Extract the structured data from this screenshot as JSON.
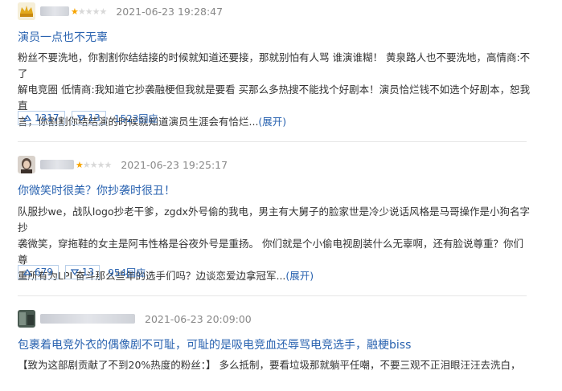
{
  "reviews": [
    {
      "stars": {
        "on": "★",
        "off": "★★★★"
      },
      "time": "2021-06-23 19:28:47",
      "title": "演员一点也不无辜",
      "lines": [
        "粉丝不要洗地，你割割你结结接的时候就知道还要接，那就别怕有人骂 谁演谁糊！ 黄泉路人也不要洗地，高情商:不了",
        "解电竞圈 低情商:我知道它抄袭融梗但我就是要看 买那么多热搜不能找个好剧本！演员恰烂钱不如选个好剧本，恕我直",
        "言，你割割你结结演的时候就知道演员生涯会有恰烂..."
      ],
      "expand": "(展开)",
      "upvotes": "1317",
      "downvotes": "13",
      "replies": "1523回应"
    },
    {
      "stars": {
        "on": "★",
        "off": "★★★★"
      },
      "time": "2021-06-23 19:25:17",
      "title": "你微笑时很美？你抄袭时很丑！",
      "lines": [
        "队服抄we，战队logo抄老干爹，zgdx外号偷的我电，男主有大舅子的脸家世是冷少说话风格是马哥操作是小狗名字抄",
        "袭微笑，穿拖鞋的女主是阿韦性格是谷夜外号是重扬。 你们就是个小偷电视剧装什么无辜啊，还有脸说尊重？你们尊",
        "重所有为LPL奋斗那么些年的选手们吗？边谈恋爱边拿冠军..."
      ],
      "expand": "(展开)",
      "upvotes": "679",
      "downvotes": "13",
      "replies": "954回应"
    },
    {
      "stars": {
        "on": "",
        "off": ""
      },
      "time": "2021-06-23 20:09:00",
      "title": "包裹着电竞外衣的偶像剧不可耻，可耻的是吸电竞血还辱骂电竞选手，融梗biss",
      "lines": [
        "【致为这部剧贡献了不到20%热度的粉丝：】 多么抵制，要看垃圾那就躺平任嘲，不要三观不正泪眼汪汪去洗白，"
      ],
      "expand": "",
      "upvotes": "",
      "downvotes": "",
      "replies": ""
    }
  ],
  "colors": {
    "link": "#2a63b0",
    "star_on": "#f7a400",
    "star_off": "#d8d8d8",
    "meta_gray": "#888888",
    "vote_border": "#b9cfe9"
  },
  "icons": {
    "upvote": "triangle-up-icon",
    "downvote": "triangle-down-icon"
  }
}
